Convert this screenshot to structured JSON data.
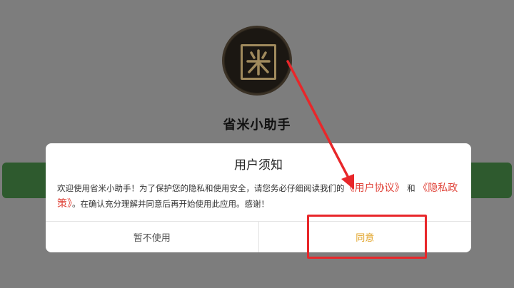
{
  "app": {
    "logo_char": "米",
    "name": "省米小助手"
  },
  "dialog": {
    "title": "用户须知",
    "body": {
      "text_before": "欢迎使用省米小助手！为了保护您的隐私和使用安全，请您务必仔细阅读我们的",
      "link_agreement": "《用户协议》",
      "text_and": "和",
      "link_privacy": "《隐私政策》",
      "text_after": "。在确认充分理解并同意后再开始使用此应用。感谢！"
    },
    "buttons": {
      "decline": "暂不使用",
      "accept": "同意"
    }
  },
  "colors": {
    "background": "#7d7d7d",
    "link": "#e0443a",
    "accept": "#e0a020",
    "annotation": "#e8272a"
  }
}
